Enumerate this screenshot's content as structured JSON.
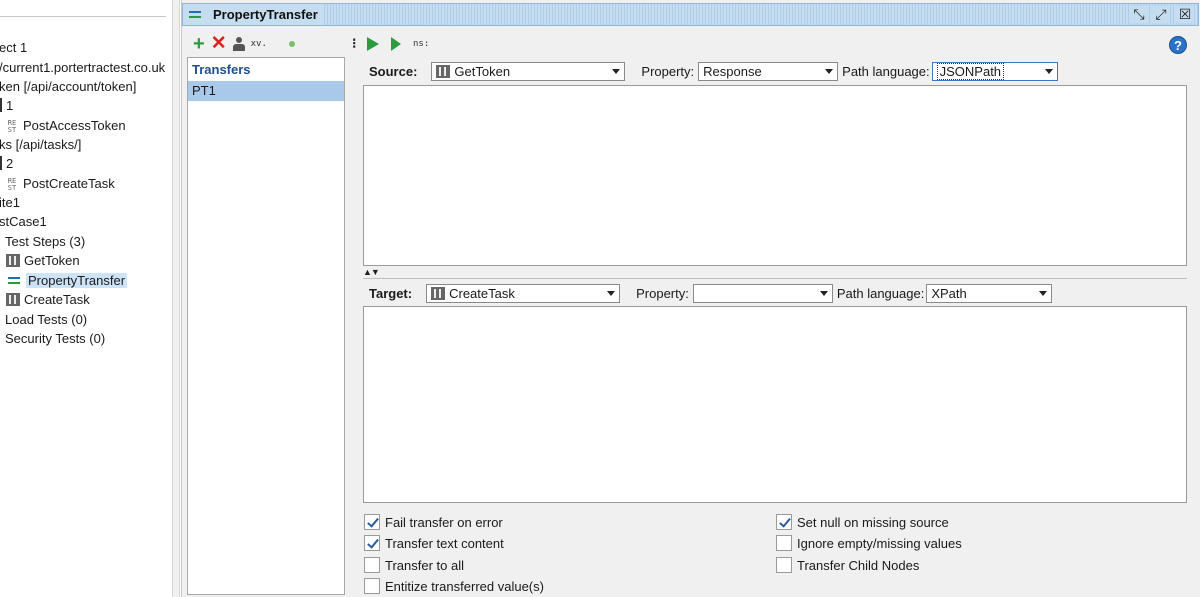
{
  "navigator": {
    "items": [
      {
        "text": "ect 1"
      },
      {
        "text": "/current1.portertractest.co.uk"
      },
      {
        "text": "ken [/api/account/token]"
      },
      {
        "text": "1"
      },
      {
        "text": "PostAccessToken"
      },
      {
        "text": "ks [/api/tasks/]"
      },
      {
        "text": "2"
      },
      {
        "text": "PostCreateTask"
      },
      {
        "text": "ite1"
      },
      {
        "text": "stCase1"
      },
      {
        "text": "Test Steps (3)"
      },
      {
        "text": "GetToken"
      },
      {
        "text": "PropertyTransfer"
      },
      {
        "text": "CreateTask"
      },
      {
        "text": "Load Tests (0)"
      },
      {
        "text": "Security Tests (0)"
      }
    ],
    "rest_icon": "RE\nST"
  },
  "window": {
    "title": "PropertyTransfer",
    "title_icon": "property-transfer-icon"
  },
  "transfers_toolbar": {
    "add_icon": "+",
    "delete_icon": "✕",
    "xml_label": "xv.",
    "run_icon": "▶"
  },
  "transfers": {
    "header": "Transfers",
    "items": [
      "PT1"
    ]
  },
  "config_toolbar": {
    "ns_label": "ns:",
    "help_icon": "?"
  },
  "source": {
    "label": "Source:",
    "step": "GetToken",
    "property_label": "Property:",
    "property": "Response",
    "path_language_label": "Path language:",
    "path_language": "JSONPath"
  },
  "target": {
    "label": "Target:",
    "step": "CreateTask",
    "property_label": "Property:",
    "property": "",
    "path_language_label": "Path language:",
    "path_language": "XPath"
  },
  "options": {
    "fail_transfer_on_error": {
      "label": "Fail transfer on error",
      "checked": true
    },
    "transfer_text_content": {
      "label": "Transfer text content",
      "checked": true
    },
    "transfer_to_all": {
      "label": "Transfer to all",
      "checked": false
    },
    "entitize_transferred_values": {
      "label": "Entitize transferred value(s)",
      "checked": false
    },
    "set_null_on_missing_source": {
      "label": "Set null on missing source",
      "checked": true
    },
    "ignore_empty_missing_values": {
      "label": "Ignore empty/missing values",
      "checked": false
    },
    "transfer_child_nodes": {
      "label": "Transfer Child Nodes",
      "checked": false
    }
  },
  "colors": {
    "accent_blue": "#1f4e8a",
    "selection": "#a9c9ea",
    "run_green": "#2e9b3e",
    "delete_red": "#dd2222"
  }
}
